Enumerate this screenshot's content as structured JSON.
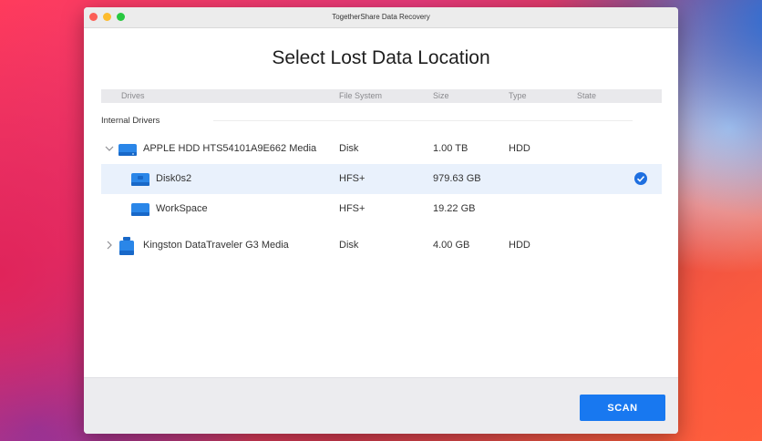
{
  "window": {
    "title": "TogetherShare Data Recovery"
  },
  "heading": "Select Lost Data Location",
  "columns": {
    "drives": "Drives",
    "file_system": "File System",
    "size": "Size",
    "type": "Type",
    "state": "State"
  },
  "section_label": "Internal Drivers",
  "rows": [
    {
      "name": "APPLE HDD HTS54101A9E662 Media",
      "file_system": "Disk",
      "size": "1.00 TB",
      "type": "HDD",
      "expanded": true,
      "level": 0,
      "selected": false
    },
    {
      "name": "Disk0s2",
      "file_system": "HFS+",
      "size": "979.63 GB",
      "type": "",
      "level": 1,
      "selected": true
    },
    {
      "name": "WorkSpace",
      "file_system": "HFS+",
      "size": "19.22 GB",
      "type": "",
      "level": 1,
      "selected": false
    },
    {
      "name": "Kingston DataTraveler G3 Media",
      "file_system": "Disk",
      "size": "4.00 GB",
      "type": "HDD",
      "expanded": false,
      "level": 0,
      "selected": false
    }
  ],
  "icons": {
    "expanded": "chevron-down-icon",
    "collapsed": "chevron-right-icon",
    "drive": "hard-drive-icon",
    "usb": "usb-drive-icon",
    "selected": "checkmark-circle-icon"
  },
  "colors": {
    "accent": "#1878f0",
    "selected_row": "#e9f1fc",
    "drive_icon": "#2a86e8"
  },
  "footer": {
    "scan_label": "SCAN"
  }
}
